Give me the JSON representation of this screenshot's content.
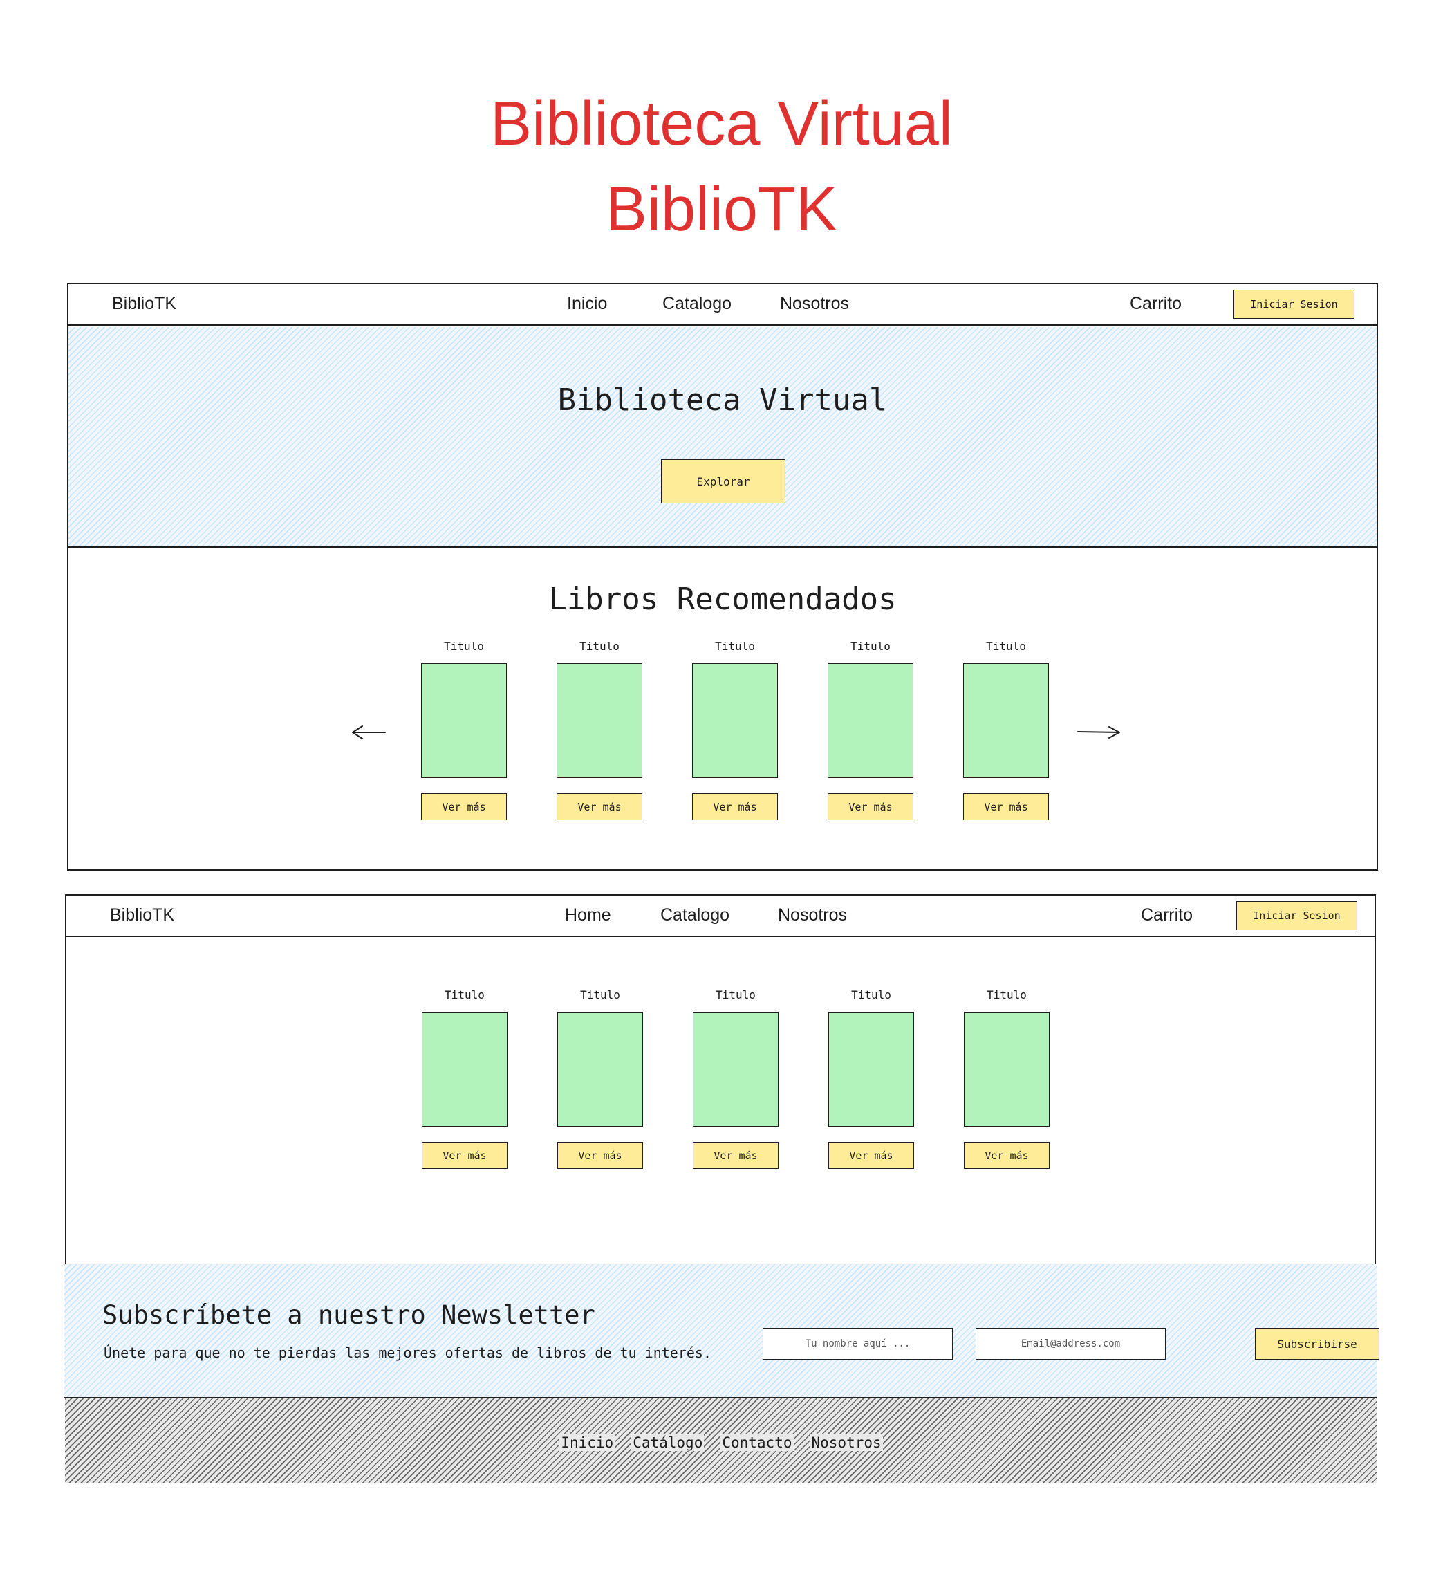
{
  "heading": {
    "line1": "Biblioteca Virtual",
    "line2": "BiblioTK"
  },
  "screen1": {
    "nav": {
      "brand": "BiblioTK",
      "links": [
        "Inicio",
        "Catalogo",
        "Nosotros"
      ],
      "cart": "Carrito",
      "login_button": "Iniciar Sesion"
    },
    "hero": {
      "title": "Biblioteca Virtual",
      "button": "Explorar"
    },
    "recommended": {
      "title": "Libros Recomendados",
      "books": [
        {
          "title": "Titulo",
          "button": "Ver más"
        },
        {
          "title": "Titulo",
          "button": "Ver más"
        },
        {
          "title": "Titulo",
          "button": "Ver más"
        },
        {
          "title": "Titulo",
          "button": "Ver más"
        },
        {
          "title": "Titulo",
          "button": "Ver más"
        }
      ]
    }
  },
  "screen2": {
    "nav": {
      "brand": "BiblioTK",
      "links": [
        "Home",
        "Catalogo",
        "Nosotros"
      ],
      "cart": "Carrito",
      "login_button": "Iniciar Sesion"
    },
    "books": [
      {
        "title": "Titulo",
        "button": "Ver más"
      },
      {
        "title": "Titulo",
        "button": "Ver más"
      },
      {
        "title": "Titulo",
        "button": "Ver más"
      },
      {
        "title": "Titulo",
        "button": "Ver más"
      },
      {
        "title": "Titulo",
        "button": "Ver más"
      }
    ],
    "newsletter": {
      "title": "Subscríbete a nuestro Newsletter",
      "subtitle": "Únete para que no te pierdas las mejores ofertas de libros de tu interés.",
      "name_placeholder": "Tu nombre aquí ...",
      "email_placeholder": "Email@address.com",
      "button": "Subscribirse"
    },
    "footer": {
      "links": [
        "Inicio",
        "Catálogo",
        "Contacto",
        "Nosotros"
      ]
    }
  },
  "colors": {
    "heading": "#e03131",
    "button_fill": "#ffec99",
    "book_fill": "#b2f2bb",
    "hatch_blue": "#a5d8ff"
  },
  "icons": {
    "prev": "arrow-left-icon",
    "next": "arrow-right-icon"
  }
}
